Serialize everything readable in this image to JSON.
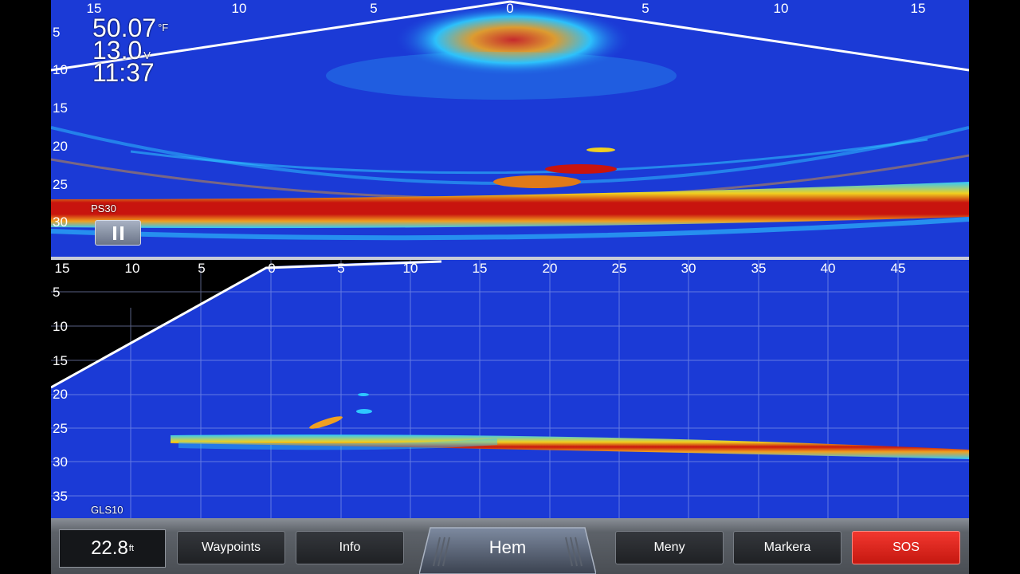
{
  "top_sonar": {
    "source_label": "PS30",
    "readouts": {
      "water_temp": "50.07",
      "water_temp_unit": "°F",
      "voltage": "13.0",
      "voltage_unit": "V",
      "time": "11:37"
    },
    "x_ticks": [
      "15",
      "10",
      "5",
      "0",
      "5",
      "10",
      "15"
    ],
    "y_ticks": [
      "5",
      "10",
      "15",
      "20",
      "25",
      "30"
    ],
    "paused": true
  },
  "bottom_sonar": {
    "source_label": "GLS10",
    "x_ticks": [
      "15",
      "10",
      "5",
      "0",
      "5",
      "10",
      "15",
      "20",
      "25",
      "30",
      "35",
      "40",
      "45"
    ],
    "y_ticks": [
      "5",
      "10",
      "15",
      "20",
      "25",
      "30",
      "35"
    ]
  },
  "colors": {
    "water": "#1b3ad6",
    "return_strong": "#c8140e",
    "return_mid": "#f0a020",
    "return_weak": "#2ec8ff",
    "sos": "#e8291f"
  },
  "toolbar": {
    "depth_value": "22.8",
    "depth_unit": "ft",
    "waypoints_label": "Waypoints",
    "info_label": "Info",
    "home_label": "Hem",
    "menu_label": "Meny",
    "mark_label": "Markera",
    "sos_label": "SOS"
  }
}
